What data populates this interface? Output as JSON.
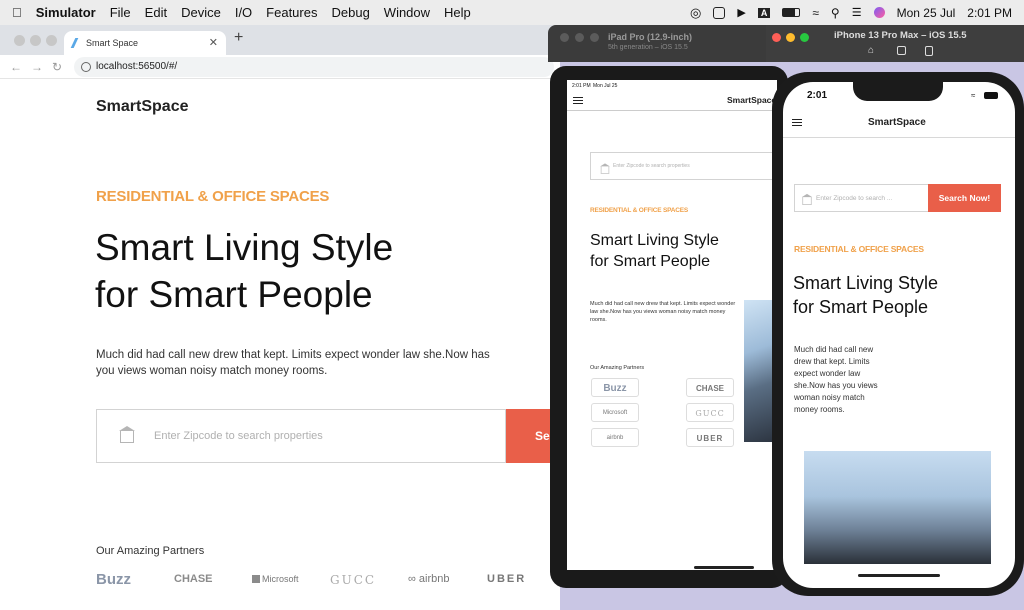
{
  "menubar": {
    "app": "Simulator",
    "items": [
      "File",
      "Edit",
      "Device",
      "I/O",
      "Features",
      "Debug",
      "Window",
      "Help"
    ],
    "date": "Mon 25 Jul",
    "time": "2:01 PM"
  },
  "browser": {
    "tab_title": "Smart Space",
    "url": "localhost:56500/#/"
  },
  "site": {
    "brand": "SmartSpace",
    "tagline": "RESIDENTIAL & OFFICE SPACES",
    "hero_line1": "Smart Living Style",
    "hero_line2": "for Smart People",
    "description": "Much did had call new drew that kept. Limits expect wonder law she.Now has you views woman noisy match money rooms.",
    "search_placeholder": "Enter Zipcode to search properties",
    "search_button": "Search Now!",
    "search_button_cut": "Sea",
    "partners_title": "Our Amazing Partners",
    "partners": [
      "Buzz",
      "CHASE",
      "Microsoft",
      "GUCC",
      "airbnb",
      "UBER"
    ]
  },
  "ipad": {
    "title": "iPad Pro (12.9-inch)",
    "subtitle": "5th generation – iOS 15.5",
    "status_time": "2:01 PM",
    "status_date": "Mon Jul 25",
    "search_placeholder": "Enter Zipcode to search properties"
  },
  "iphone": {
    "title": "iPhone 13 Pro Max – iOS 15.5",
    "status_time": "2:01",
    "search_placeholder": "Enter Zipcode to search ..."
  }
}
